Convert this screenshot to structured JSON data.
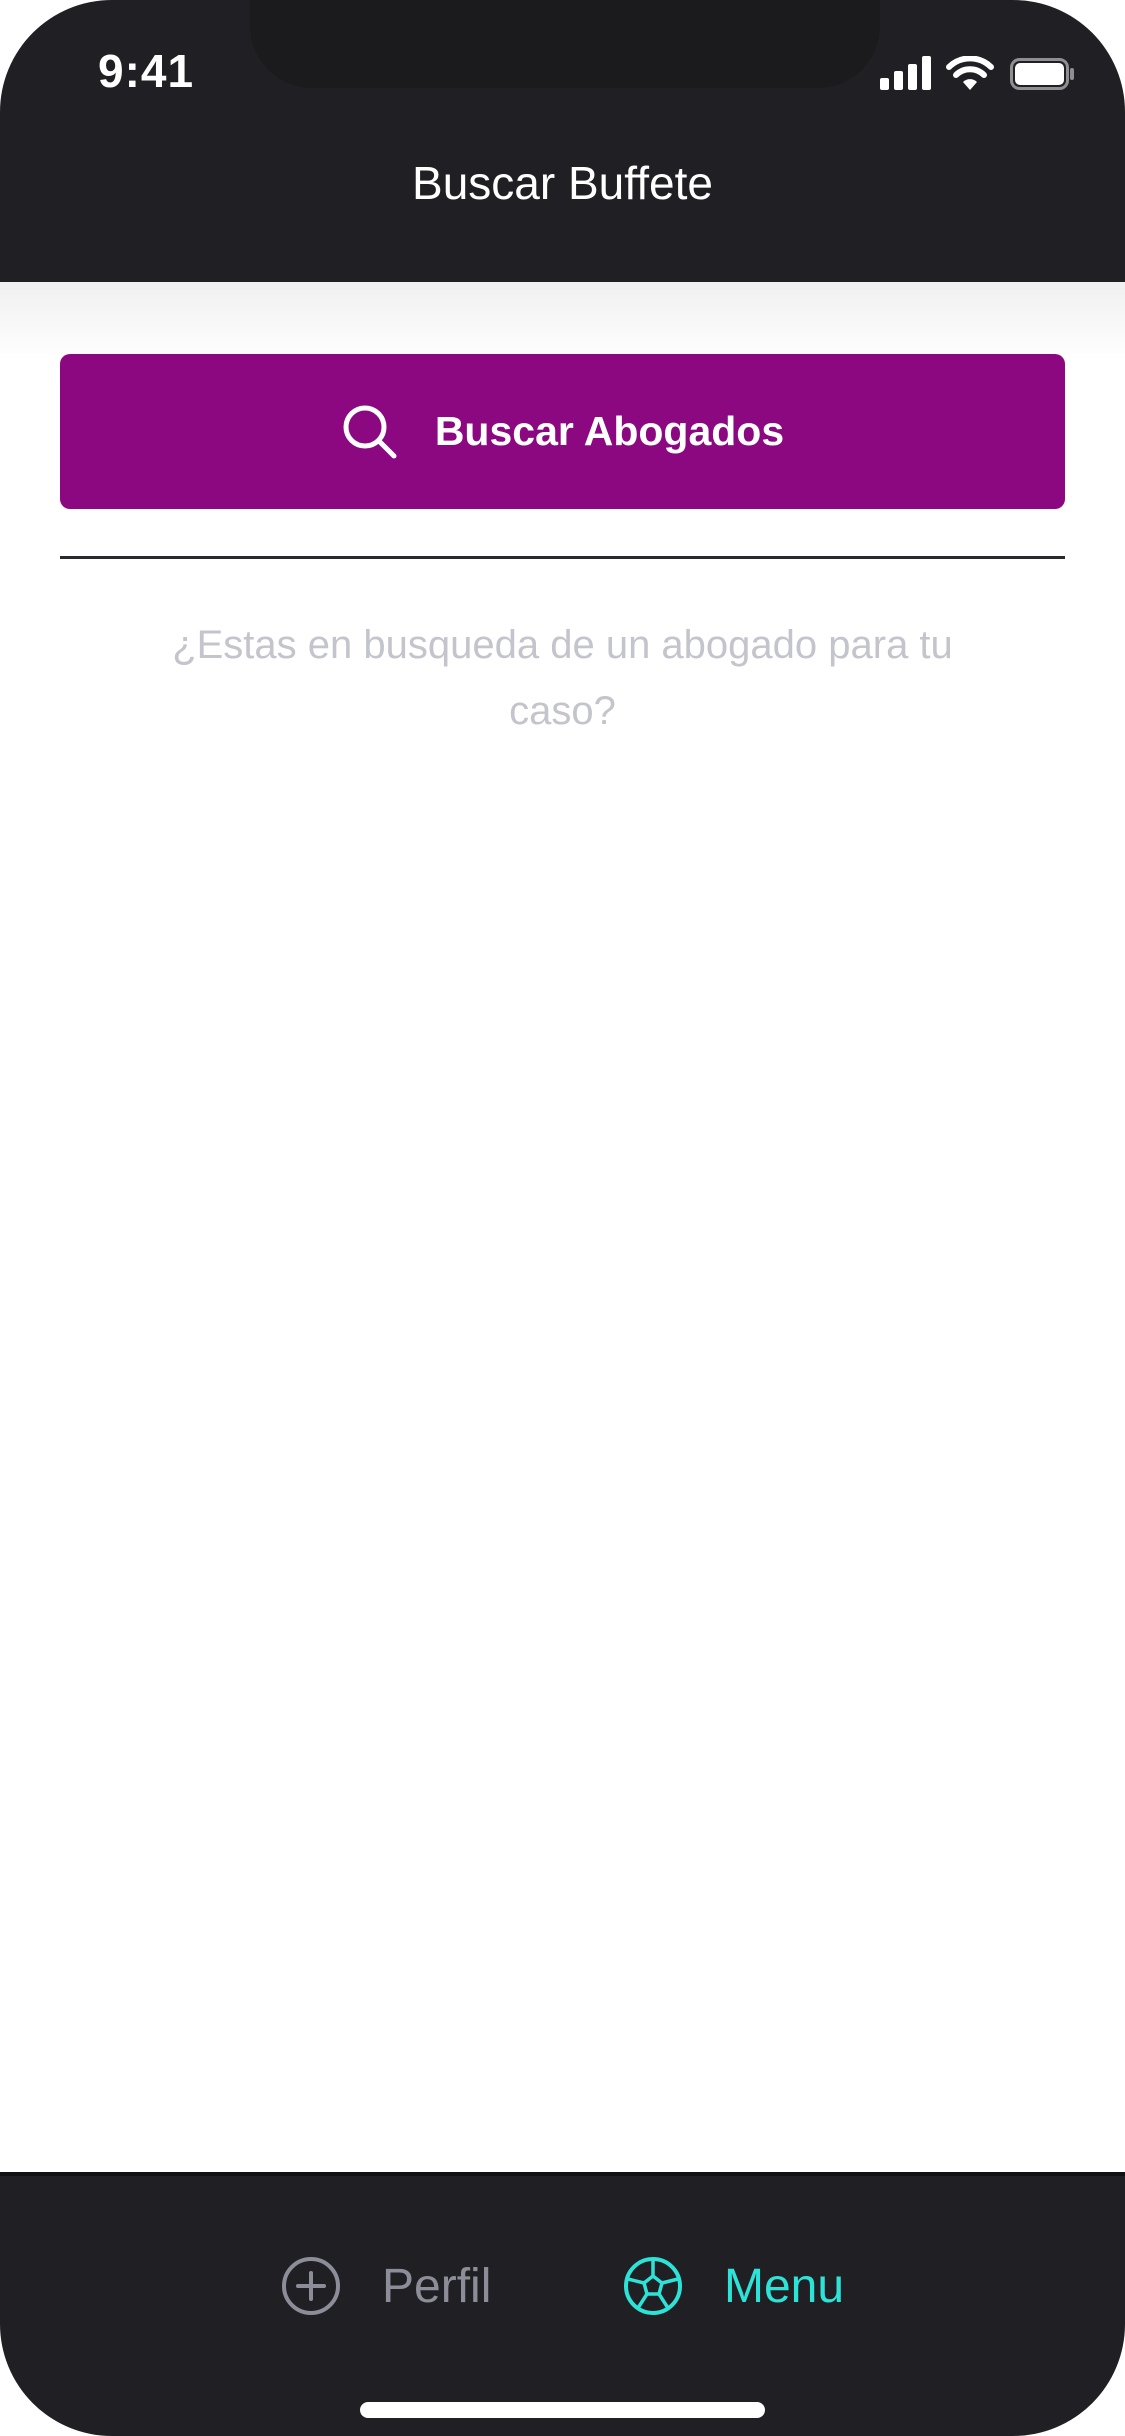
{
  "status_bar": {
    "time": "9:41"
  },
  "header": {
    "title": "Buscar Buffete"
  },
  "search_button": {
    "label": "Buscar Abogados",
    "icon": "search-icon"
  },
  "prompt": {
    "text": "¿Estas en busqueda de un abogado para tu caso?"
  },
  "tabbar": {
    "tabs": [
      {
        "label": "Perfil",
        "icon": "plus-circle-icon",
        "active": false
      },
      {
        "label": "Menu",
        "icon": "soccer-ball-icon",
        "active": true
      }
    ]
  },
  "colors": {
    "header_bg": "#202024",
    "primary": "#8b0881",
    "active_tab": "#2de3d8",
    "inactive_tab": "#8d8d99",
    "prompt_text": "#c4c4cc"
  }
}
